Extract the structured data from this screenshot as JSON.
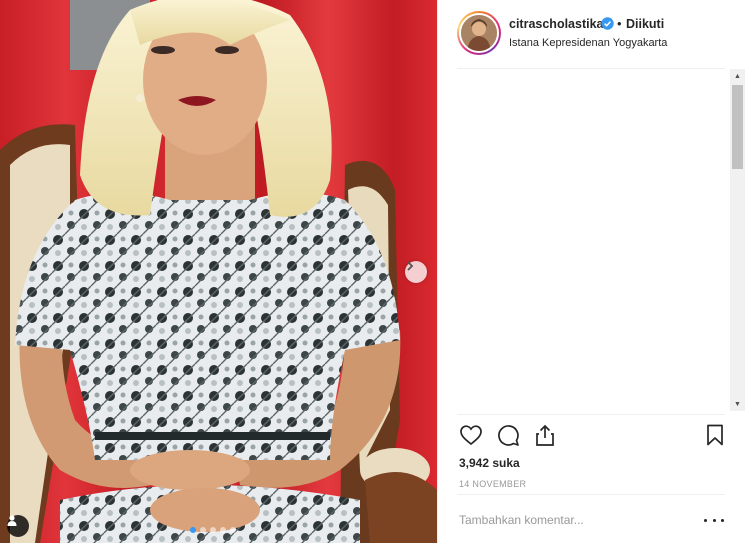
{
  "post": {
    "photo_icons": {
      "next": "chevron-right-icon",
      "tag": "user-tag-icon"
    },
    "carousel": {
      "dots": 5,
      "active_index": 0
    }
  },
  "header": {
    "username": "citrascholastika",
    "verified_icon": "verified-badge-icon",
    "separator": "•",
    "follow_status": "Diikuti",
    "location": "Istana Kepresidenan Yogyakarta"
  },
  "actions": {
    "like_icon": "heart-icon",
    "comment_icon": "comment-icon",
    "share_icon": "share-icon",
    "save_icon": "bookmark-icon"
  },
  "likes": "3,942 suka",
  "date": "14 NOVEMBER",
  "comment_box": {
    "placeholder": "Tambahkan komentar...",
    "more_icon": "more-options-icon"
  },
  "colors": {
    "accent": "#3897f0",
    "curtain": "#d8262c",
    "text": "#262626",
    "muted": "#999999"
  }
}
